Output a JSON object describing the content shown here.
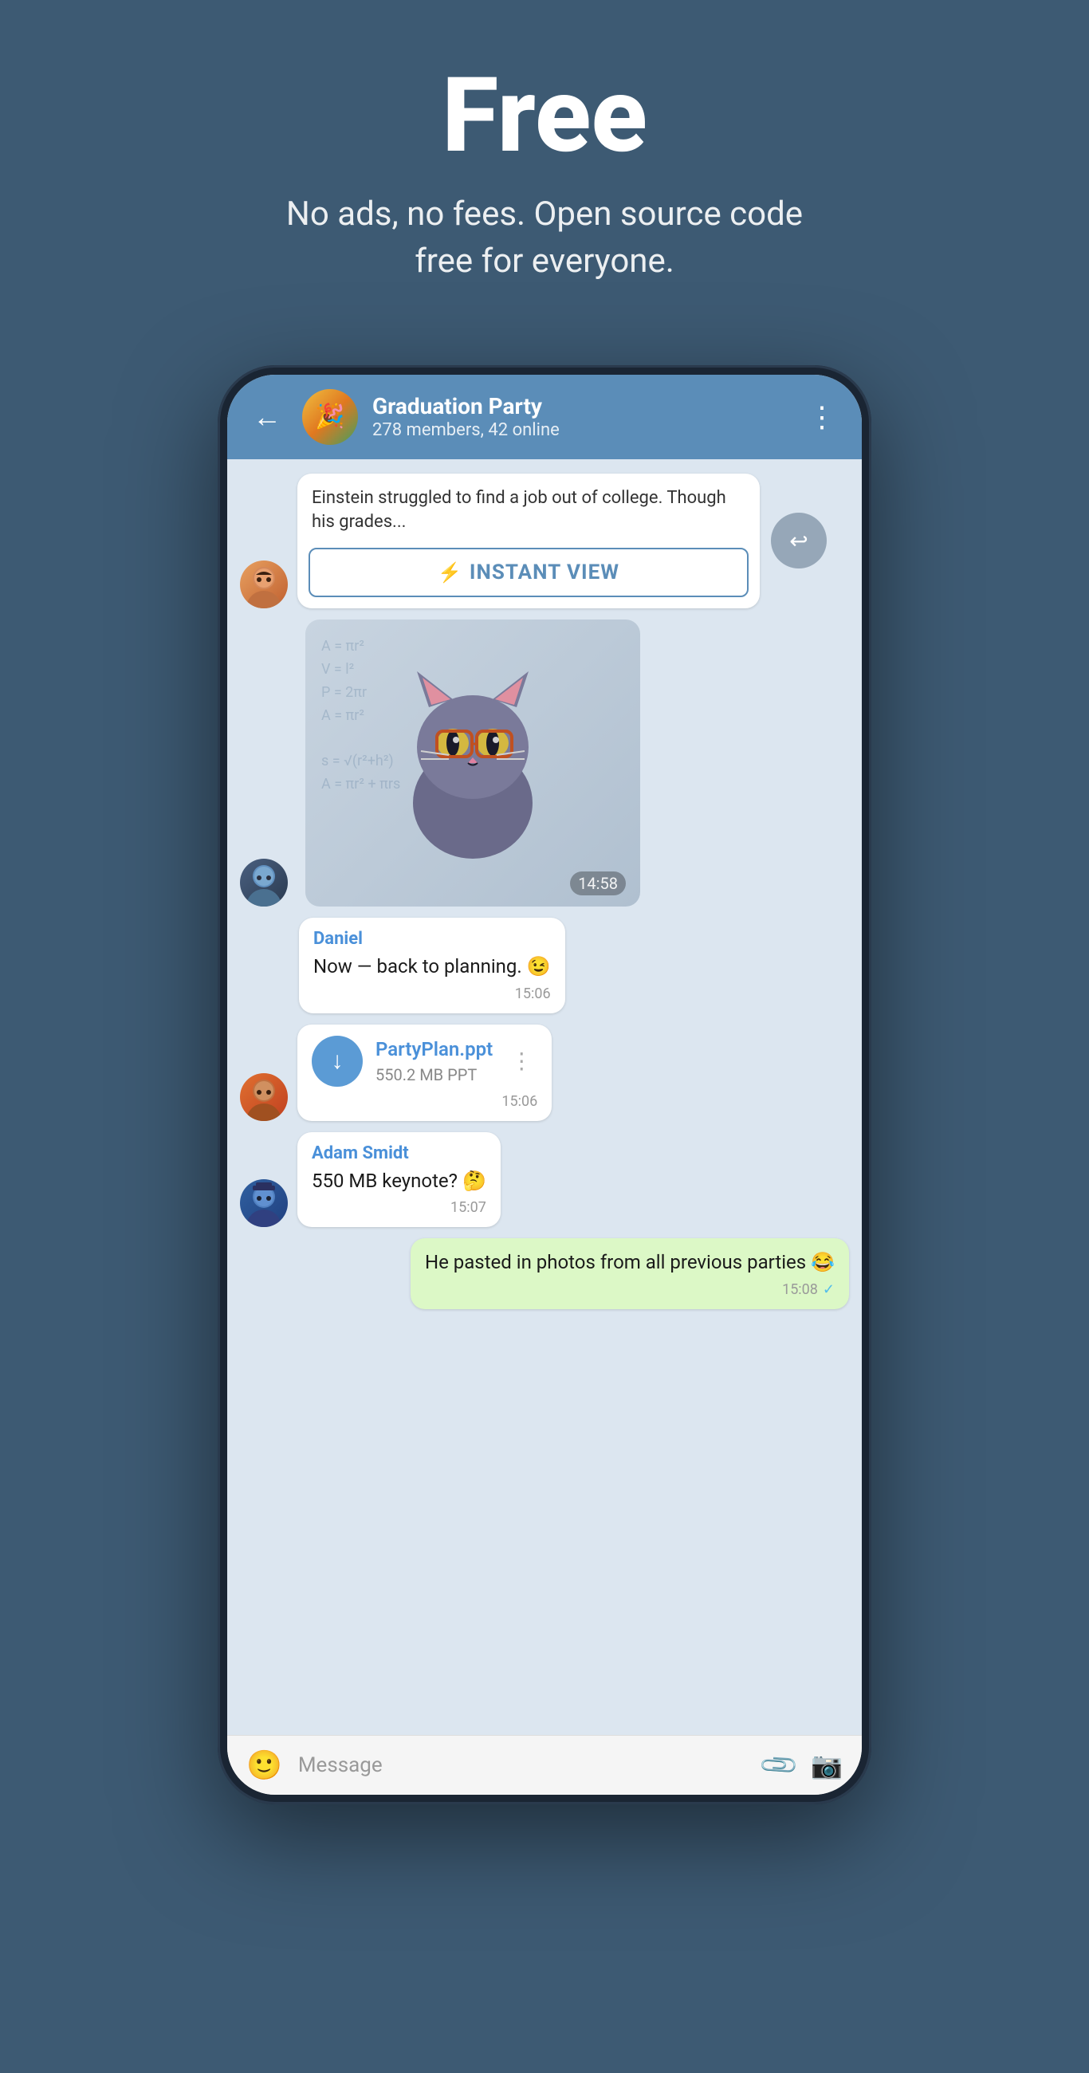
{
  "hero": {
    "title": "Free",
    "subtitle": "No ads, no fees. Open source code free for everyone."
  },
  "phone": {
    "header": {
      "back_label": "←",
      "group_name": "Graduation Party",
      "group_status": "278 members, 42 online",
      "more_label": "⋮"
    },
    "messages": [
      {
        "id": "link-preview",
        "type": "link-preview",
        "text": "Einstein struggled to find a job out of college. Though his grades...",
        "instant_view_label": "INSTANT VIEW",
        "side": "left",
        "avatar": "woman"
      },
      {
        "id": "sticker",
        "type": "sticker",
        "time": "14:58",
        "side": "left",
        "avatar": "man1"
      },
      {
        "id": "daniel-msg",
        "type": "text",
        "sender": "Daniel",
        "text": "Now — back to planning. 😉",
        "time": "15:06",
        "side": "left",
        "avatar": null
      },
      {
        "id": "file-msg",
        "type": "file",
        "file_name": "PartyPlan.ppt",
        "file_size": "550.2 MB PPT",
        "time": "15:06",
        "side": "left",
        "avatar": "man2"
      },
      {
        "id": "adam-msg",
        "type": "text",
        "sender": "Adam Smidt",
        "text": "550 MB keynote? 🤔",
        "time": "15:07",
        "side": "left",
        "avatar": "man3"
      },
      {
        "id": "self-msg",
        "type": "text",
        "sender": null,
        "text": "He pasted in photos from all previous parties 😂",
        "time": "15:08",
        "side": "right",
        "avatar": null,
        "green": true,
        "tick": true
      }
    ],
    "input": {
      "placeholder": "Message",
      "emoji_label": "🙂",
      "attach_label": "📎",
      "camera_label": "📷"
    }
  }
}
